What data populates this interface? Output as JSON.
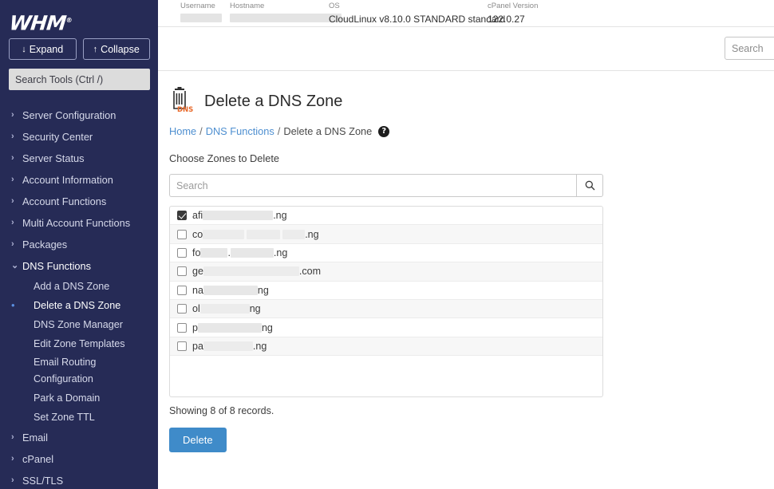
{
  "sidebar": {
    "logo": "WHM",
    "expand_label": "Expand",
    "collapse_label": "Collapse",
    "expand_icon": "arrow-down-icon",
    "collapse_icon": "arrow-up-icon",
    "search_placeholder": "Search Tools (Ctrl /)",
    "items": [
      {
        "label": "Server Configuration",
        "expanded": false
      },
      {
        "label": "Security Center",
        "expanded": false
      },
      {
        "label": "Server Status",
        "expanded": false
      },
      {
        "label": "Account Information",
        "expanded": false
      },
      {
        "label": "Account Functions",
        "expanded": false
      },
      {
        "label": "Multi Account Functions",
        "expanded": false
      },
      {
        "label": "Packages",
        "expanded": false
      },
      {
        "label": "DNS Functions",
        "expanded": true
      }
    ],
    "dns_subitems": [
      {
        "label": "Add a DNS Zone",
        "active": false
      },
      {
        "label": "Delete a DNS Zone",
        "active": true
      },
      {
        "label": "DNS Zone Manager",
        "active": false
      },
      {
        "label": "Edit Zone Templates",
        "active": false
      },
      {
        "label": "Email Routing Configuration",
        "active": false
      },
      {
        "label": "Park a Domain",
        "active": false
      },
      {
        "label": "Set Zone TTL",
        "active": false
      }
    ],
    "items_after": [
      {
        "label": "Email",
        "expanded": false
      },
      {
        "label": "cPanel",
        "expanded": false
      },
      {
        "label": "SSL/TLS",
        "expanded": false
      }
    ]
  },
  "topbar": {
    "username_label": "Username",
    "username_value": "",
    "hostname_label": "Hostname",
    "hostname_value": "",
    "os_label": "OS",
    "os_value": "CloudLinux v8.10.0 STANDARD standard",
    "cpanel_version_label": "cPanel Version",
    "cpanel_version_value": "122.0.27"
  },
  "top_search": {
    "placeholder": "Search",
    "value": ""
  },
  "page": {
    "icon": "dns-trash-icon",
    "icon_text": "DNS",
    "title": "Delete a DNS Zone",
    "breadcrumb": {
      "home": "Home",
      "section": "DNS Functions",
      "current": "Delete a DNS Zone",
      "separator": "/",
      "help_icon": "help-circle-icon"
    },
    "section_label": "Choose Zones to Delete",
    "search": {
      "placeholder": "Search",
      "value": "",
      "button_icon": "search-icon"
    },
    "records_text": "Showing 8 of 8 records.",
    "delete_label": "Delete"
  },
  "zones": [
    {
      "prefix": "afi",
      "block_widths": [
        88
      ],
      "suffix": ".ng",
      "checked": true
    },
    {
      "prefix": "co",
      "block_widths": [
        52,
        42,
        30
      ],
      "suffix": ".ng",
      "checked": false
    },
    {
      "prefix": "fo",
      "block_widths": [
        34,
        54
      ],
      "mid": ".",
      "suffix": ".ng",
      "checked": false
    },
    {
      "prefix": "ge",
      "block_widths": [
        120
      ],
      "suffix": ".com",
      "checked": false
    },
    {
      "prefix": "na",
      "block_widths": [
        68
      ],
      "suffix": "ng",
      "checked": false
    },
    {
      "prefix": "ol",
      "block_widths": [
        62
      ],
      "suffix": "ng",
      "checked": false
    },
    {
      "prefix": "p",
      "block_widths": [
        80
      ],
      "suffix": "ng",
      "checked": false
    },
    {
      "prefix": "pa",
      "block_widths": [
        62
      ],
      "suffix": ".ng",
      "checked": false
    }
  ],
  "colors": {
    "sidebar_bg": "#262b56",
    "accent_blue": "#4e8fd0",
    "delete_button": "#3f8bc9",
    "dns_orange": "#e8692a"
  }
}
